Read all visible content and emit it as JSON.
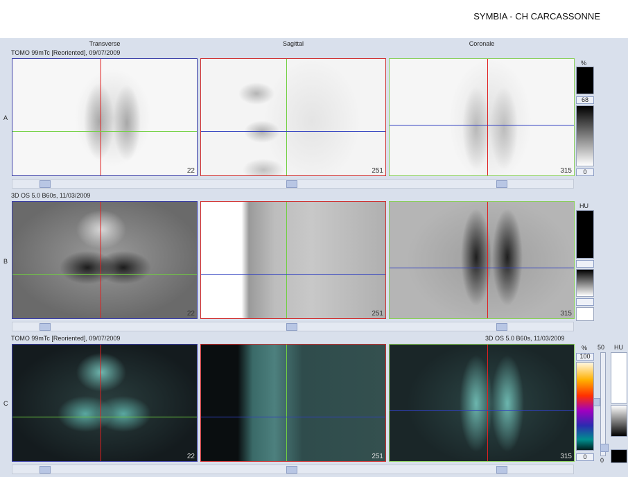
{
  "app": {
    "title": "SYMBIA - CH CARCASSONNE"
  },
  "columns": [
    "Transverse",
    "Sagittal",
    "Coronale"
  ],
  "rows": {
    "A": {
      "letter": "A",
      "series": "TOMO 99mTc [Reoriented], 09/07/2009"
    },
    "B": {
      "letter": "B",
      "series": "3D  OS  5.0  B60s, 11/03/2009"
    },
    "C": {
      "letter": "C",
      "series_left": "TOMO 99mTc [Reoriented], 09/07/2009",
      "series_right": "3D  OS  5.0  B60s, 11/03/2009"
    }
  },
  "slices": {
    "transverse": "22",
    "sagittal": "251",
    "coronal": "315"
  },
  "scales": {
    "a": {
      "unit": "%",
      "level": "68",
      "min": "0"
    },
    "b": {
      "unit": "HU"
    },
    "c": {
      "unit_pct": "%",
      "max": "100",
      "min": "0",
      "mid": "50",
      "unit_hu": "HU",
      "hu_min": "0"
    }
  },
  "colors": {
    "workspace_bg": "#d9e0ec",
    "transverse_frame": "#3b3fa8",
    "sagittal_frame": "#d03030",
    "coronal_frame": "#8ad05a",
    "crosshair_red": "#e02020",
    "crosshair_green": "#70d040",
    "crosshair_blue": "#3040c0"
  }
}
